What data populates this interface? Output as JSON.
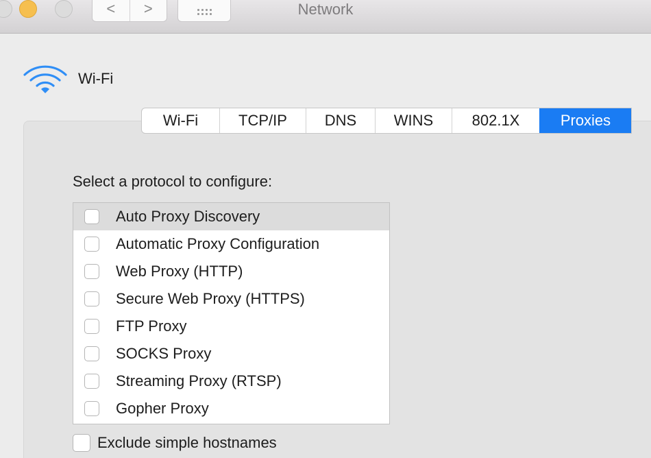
{
  "window": {
    "title": "Network"
  },
  "toolbar": {
    "back_symbol": "<",
    "forward_symbol": ">",
    "show_all_icon": "grid-icon"
  },
  "header": {
    "icon": "wifi-icon",
    "label": "Wi-Fi",
    "accent_color": "#2f8ef6"
  },
  "tabs": [
    {
      "label": "Wi-Fi",
      "active": false
    },
    {
      "label": "TCP/IP",
      "active": false
    },
    {
      "label": "DNS",
      "active": false
    },
    {
      "label": "WINS",
      "active": false
    },
    {
      "label": "802.1X",
      "active": false
    },
    {
      "label": "Proxies",
      "active": true
    }
  ],
  "proxies": {
    "prompt": "Select a protocol to configure:",
    "protocols": [
      {
        "label": "Auto Proxy Discovery",
        "checked": false,
        "selected": true
      },
      {
        "label": "Automatic Proxy Configuration",
        "checked": false,
        "selected": false
      },
      {
        "label": "Web Proxy (HTTP)",
        "checked": false,
        "selected": false
      },
      {
        "label": "Secure Web Proxy (HTTPS)",
        "checked": false,
        "selected": false
      },
      {
        "label": "FTP Proxy",
        "checked": false,
        "selected": false
      },
      {
        "label": "SOCKS Proxy",
        "checked": false,
        "selected": false
      },
      {
        "label": "Streaming Proxy (RTSP)",
        "checked": false,
        "selected": false
      },
      {
        "label": "Gopher Proxy",
        "checked": false,
        "selected": false
      }
    ],
    "exclude_simple_hostnames": {
      "label": "Exclude simple hostnames",
      "checked": false
    }
  },
  "colors": {
    "active_tab": "#1a7cf3",
    "minimize_button": "#f6bf4f"
  }
}
